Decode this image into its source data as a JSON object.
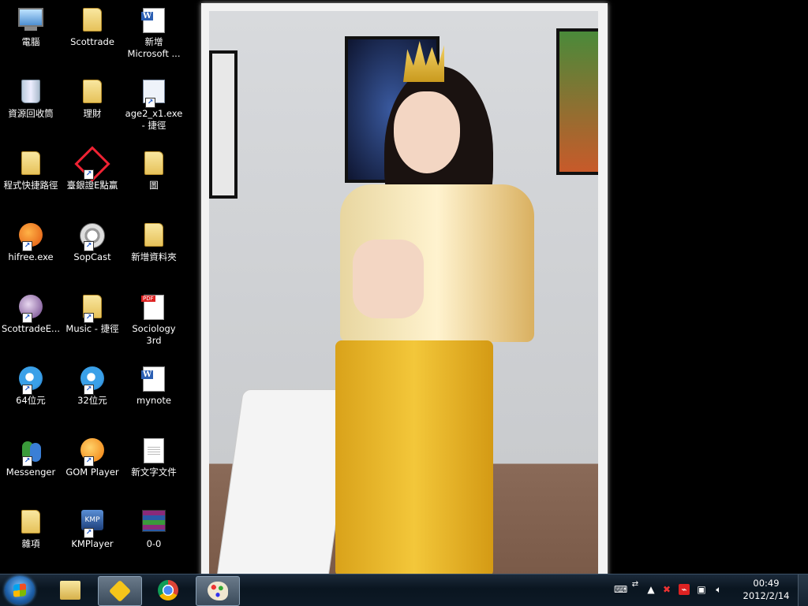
{
  "desktop": {
    "icons": [
      {
        "label": "電腦"
      },
      {
        "label": "Scottrade"
      },
      {
        "label": "新增 Microsoft ..."
      },
      {
        "label": "資源回收筒"
      },
      {
        "label": "理財"
      },
      {
        "label": "age2_x1.exe - 捷徑"
      },
      {
        "label": "程式快捷路徑"
      },
      {
        "label": "臺銀證E點贏"
      },
      {
        "label": "圖"
      },
      {
        "label": "hifree.exe"
      },
      {
        "label": "SopCast"
      },
      {
        "label": "新增資料夾"
      },
      {
        "label": "ScottradeE..."
      },
      {
        "label": "Music - 捷徑"
      },
      {
        "label": "Sociology 3rd"
      },
      {
        "label": "64位元"
      },
      {
        "label": "32位元"
      },
      {
        "label": "mynote"
      },
      {
        "label": "Messenger"
      },
      {
        "label": "GOM Player"
      },
      {
        "label": "新文字文件"
      },
      {
        "label": "雜項"
      },
      {
        "label": "KMPlayer"
      },
      {
        "label": "0-0"
      }
    ]
  },
  "taskbar": {
    "clock_time": "00:49",
    "clock_date": "2012/2/14",
    "colors": {
      "accent": "#1d5fa8",
      "bar": "#0a1520"
    }
  }
}
